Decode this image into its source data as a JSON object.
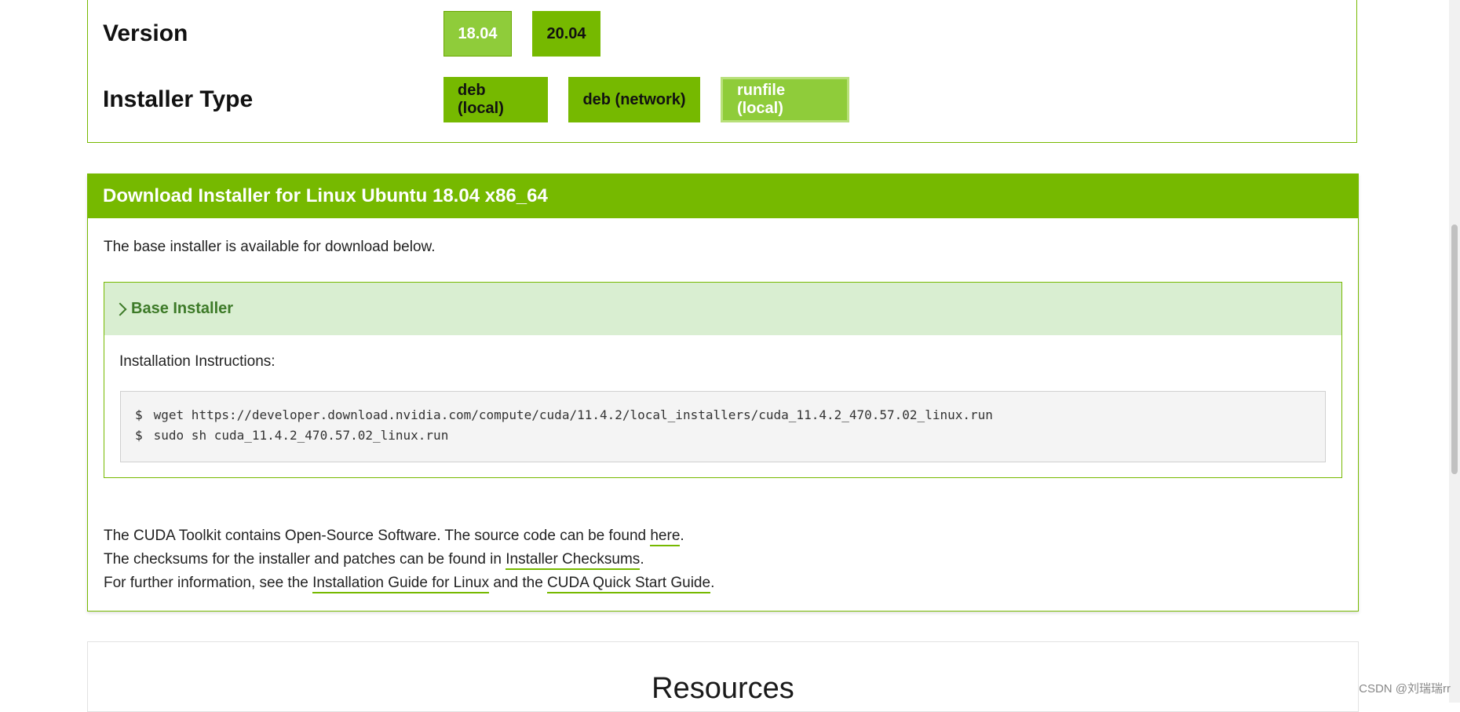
{
  "selector": {
    "version_label": "Version",
    "versions": [
      "18.04",
      "20.04"
    ],
    "installer_type_label": "Installer Type",
    "installer_types": [
      "deb (local)",
      "deb (network)",
      "runfile (local)"
    ]
  },
  "download": {
    "title": "Download Installer for Linux Ubuntu 18.04 x86_64",
    "note": "The base installer is available for download below.",
    "base_installer": {
      "title": "Base Installer",
      "instructions_label": "Installation Instructions:",
      "prompt": "$",
      "commands": [
        "wget https://developer.download.nvidia.com/compute/cuda/11.4.2/local_installers/cuda_11.4.2_470.57.02_linux.run",
        "sudo sh cuda_11.4.2_470.57.02_linux.run"
      ]
    },
    "info": {
      "line1_text": "The CUDA Toolkit contains Open-Source Software. The source code can be found ",
      "line1_link": "here",
      "line2_text": "The checksums for the installer and patches can be found in ",
      "line2_link": "Installer Checksums",
      "line3_text": "For further information, see the ",
      "line3_link1": "Installation Guide for Linux",
      "line3_mid": " and the ",
      "line3_link2": "CUDA Quick Start Guide",
      "period": "."
    }
  },
  "resources": {
    "title": "Resources"
  },
  "watermark": "CSDN @刘瑞瑞rr",
  "colors": {
    "accent": "#76b900",
    "accent_light": "#8fcc3a",
    "panel_head": "#d9eed1"
  }
}
